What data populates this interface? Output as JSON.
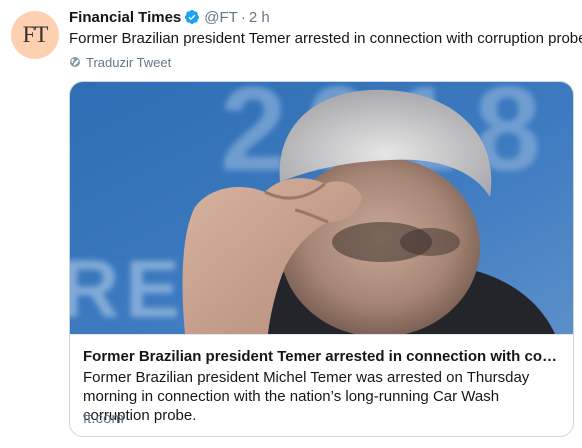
{
  "tweet": {
    "avatar_text": "FT",
    "author_name": "Financial Times",
    "handle": "@FT",
    "separator": "·",
    "time": "2 h",
    "text": "Former Brazilian president Temer arrested in connection with corruption probe",
    "translate_label": "Traduzir Tweet",
    "icons": [
      "verified-badge-icon",
      "globe-icon"
    ]
  },
  "card": {
    "image_background_text": "2018",
    "image_lower_text": "RE",
    "title": "Former Brazilian president Temer arrested in connection with corrupt...",
    "description": "Former Brazilian president Michel Temer was arrested on Thursday morning in connection with the nation’s long-running Car Wash corruption probe.",
    "domain": "ft.com"
  },
  "colors": {
    "avatar_bg": "#fcd0b1",
    "verified": "#1da1f2",
    "secondary_text": "#657786",
    "card_border": "#ccd6dd",
    "photo_background": "#3f78b5"
  }
}
